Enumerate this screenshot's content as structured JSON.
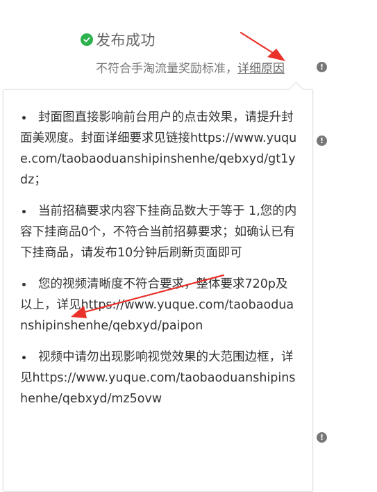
{
  "header": {
    "title": "发布成功",
    "icon": "check-circle-icon",
    "icon_color": "#2bb24c"
  },
  "subtitle": {
    "text": "不符合手淘流量奖励标准，",
    "link": "详细原因"
  },
  "popover": {
    "items": [
      {
        "text": "封面图直接影响前台用户的点击效果，请提升封面美观度。封面详细要求见链接",
        "url": "https://www.yuque.com/taobaoduanshipinshenhe/qebxyd/gt1ydz",
        "suffix": "；"
      },
      {
        "text": "当前招稿要求内容下挂商品数大于等于 1,您的内容下挂商品0个，不符合当前招募要求；如确认已有下挂商品，请发布10分钟后刷新页面即可",
        "url": "",
        "suffix": ""
      },
      {
        "text": "您的视频清晰度不符合要求，整体要求720p及以上，详见",
        "url": "https://www.yuque.com/taobaoduanshipinshenhe/qebxyd/paipon",
        "suffix": ""
      },
      {
        "text": "视频中请勿出现影响视觉效果的大范围边框，详见",
        "url": "https://www.yuque.com/taobaoduanshipinshenhe/qebxyd/mz5ovw",
        "suffix": ""
      }
    ]
  },
  "colors": {
    "annotation_arrow": "#e8322a",
    "info_icon": "#777777"
  }
}
